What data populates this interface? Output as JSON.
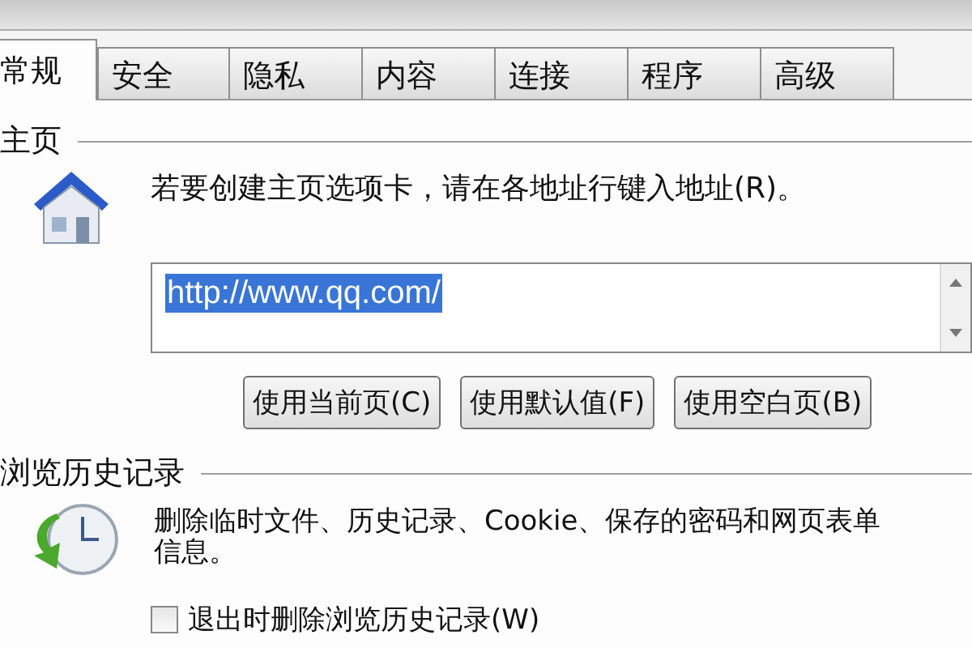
{
  "tabs": [
    {
      "label": "常规",
      "selected": true
    },
    {
      "label": "安全",
      "selected": false
    },
    {
      "label": "隐私",
      "selected": false
    },
    {
      "label": "内容",
      "selected": false
    },
    {
      "label": "连接",
      "selected": false
    },
    {
      "label": "程序",
      "selected": false
    },
    {
      "label": "高级",
      "selected": false
    }
  ],
  "home_page": {
    "title": "主页",
    "description": "若要创建主页选项卡，请在各地址行键入地址(R)。",
    "address": {
      "value": "http://www.qq.com/",
      "selected": true
    },
    "buttons": [
      "使用当前页(C)",
      "使用默认值(F)",
      "使用空白页(B)"
    ]
  },
  "browsing_history": {
    "title": "浏览历史记录",
    "description": "删除临时文件、历史记录、Cookie、保存的密码和网页表单信息。",
    "delete_on_exit": {
      "label": "退出时删除浏览历史记录(W)",
      "checked": false
    }
  }
}
